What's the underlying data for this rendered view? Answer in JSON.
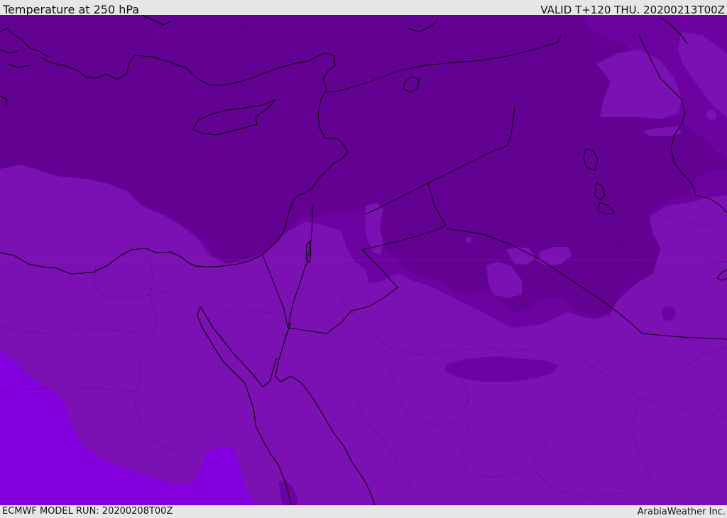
{
  "header": {
    "title": "Temperature at 250 hPa",
    "valid": "VALID T+120 THU. 20200213T00Z"
  },
  "footer": {
    "model_run": "ECMWF MODEL RUN: 20200208T00Z",
    "credit": "ArabiaWeather Inc."
  },
  "colors": {
    "bar_background": "#e6e6e6",
    "band_coldest": "#630193",
    "band_cold": "#6c03a0",
    "band_mid": "#7b11b3",
    "band_warm": "#8400df",
    "coastline": "#000000"
  },
  "map": {
    "field": "temperature",
    "level": "250 hPa",
    "style": "filled color bands with black coastlines, solid country borders and dotted province borders"
  }
}
